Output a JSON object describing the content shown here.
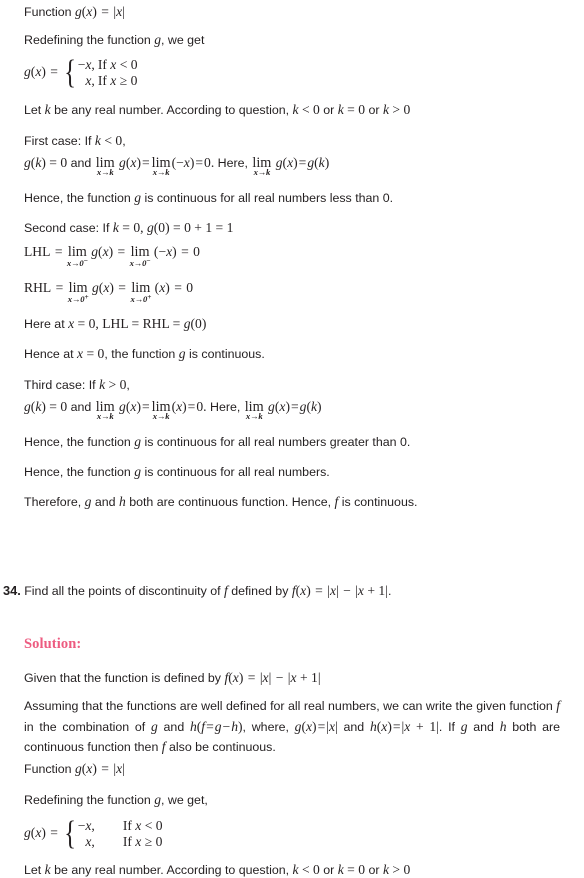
{
  "document": {
    "accent_color": "#ed5b80",
    "text_color": "#231f20",
    "background": "#ffffff"
  },
  "blocks": {
    "line_function_g_top": "Function g(x) = |x|",
    "line_redefining_top": "Redefining the function g, we get",
    "piecewise_top": {
      "lhs": "g(x) =",
      "rows": [
        {
          "value": "−x,",
          "condition": "If x < 0"
        },
        {
          "value": "x,",
          "condition": "If x ≥ 0"
        }
      ]
    },
    "line_let_k_top": "Let k be any real number. According to question, k < 0 or k = 0 or k > 0",
    "line_first_case": "First case: If k < 0,",
    "eq_first_case": "g(k) = 0 and lim_{x→k} g(x) = lim_{x→k}(−x) = 0. Here, lim_{x→k} g(x) = g(k)",
    "line_hence_less": "Hence, the function g is continuous for all real numbers less than 0.",
    "line_second_case": "Second case: If k = 0, g(0) = 0 + 1 = 1",
    "eq_lhl": "LHL = lim_{x→0⁻} g(x) = lim_{x→0⁻} (−x) = 0",
    "eq_rhl": "RHL = lim_{x→0⁺} g(x) = lim_{x→0⁺} (x) = 0",
    "line_here_at_zero": "Here at x = 0, LHL = RHL = g(0)",
    "line_hence_at_zero": "Hence at x = 0, the function g is continuous.",
    "line_third_case": "Third case: If k > 0,",
    "eq_third_case": "g(k) = 0 and lim_{x→k} g(x) = lim_{x→k}(x) = 0. Here, lim_{x→k} g(x) = g(k)",
    "line_hence_greater": "Hence, the function g is continuous for all real numbers greater than 0.",
    "line_hence_all": "Hence, the function g is continuous for all real numbers.",
    "line_therefore": "Therefore, g and h both are continuous function. Hence, f is continuous."
  },
  "question": {
    "number": "34.",
    "text_before": "Find all the points of discontinuity of",
    "f_symbol": "f",
    "text_mid": "defined by",
    "equation": "f(x) = |x| − |x + 1|.",
    "full_text": "34. Find all the points of discontinuity of f defined by f(x) = |x| − |x + 1|."
  },
  "solution": {
    "heading": "Solution:",
    "line_given": "Given that the function is defined by f(x) = |x| − |x + 1|",
    "paragraph_assuming": "Assuming that the functions are well defined for all real numbers, we can write the given function f in the combination of g and h(f = g − h), where, g(x) = |x| and h(x) = |x + 1|. If g and h both are continuous function then f also be continuous.",
    "line_function_g": "Function g(x) = |x|",
    "line_redefining": "Redefining the function g, we get,",
    "piecewise_bottom": {
      "lhs": "g(x) =",
      "rows": [
        {
          "value": "−x,",
          "condition": "If x < 0"
        },
        {
          "value": "x,",
          "condition": "If x ≥ 0"
        }
      ]
    },
    "line_let_k": "Let k be any real number. According to question, k < 0 or k = 0 or k > 0"
  },
  "symbols": {
    "g": "g",
    "h": "h",
    "f": "f",
    "x": "x",
    "k": "k",
    "lim": "lim",
    "arrow": "→",
    "minus": "−",
    "geq": "≥",
    "lt": "<",
    "gt": ">",
    "eq": "="
  }
}
